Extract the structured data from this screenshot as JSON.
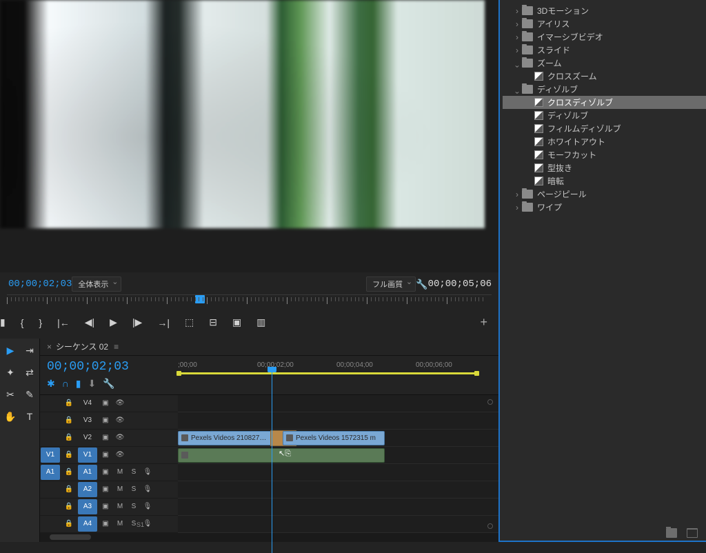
{
  "preview": {
    "timecode_left": "00;00;02;03",
    "fit_dropdown": "全体表示",
    "quality_dropdown": "フル画質",
    "timecode_right": "00;00;05;06"
  },
  "transport": {
    "add_marker": "▼",
    "mark_in": "{",
    "mark_out": "}",
    "go_in": "|←",
    "step_back": "◀|",
    "play": "▶",
    "step_fwd": "|▶",
    "go_out": "→|",
    "lift": "⬚",
    "extract": "⬚⬚",
    "snapshot": "📷",
    "export": "▦"
  },
  "effects": {
    "items": [
      {
        "type": "folder",
        "level": 1,
        "arrow": "closed",
        "label": "3Dモーション"
      },
      {
        "type": "folder",
        "level": 1,
        "arrow": "closed",
        "label": "アイリス"
      },
      {
        "type": "folder",
        "level": 1,
        "arrow": "closed",
        "label": "イマーシブビデオ"
      },
      {
        "type": "folder",
        "level": 1,
        "arrow": "closed",
        "label": "スライド"
      },
      {
        "type": "folder",
        "level": 1,
        "arrow": "open",
        "label": "ズーム"
      },
      {
        "type": "effect",
        "level": 2,
        "label": "クロスズーム"
      },
      {
        "type": "folder",
        "level": 1,
        "arrow": "open",
        "label": "ディゾルブ"
      },
      {
        "type": "effect",
        "level": 2,
        "label": "クロスディゾルブ",
        "selected": true
      },
      {
        "type": "effect",
        "level": 2,
        "label": "ディゾルブ"
      },
      {
        "type": "effect",
        "level": 2,
        "label": "フィルムディゾルブ"
      },
      {
        "type": "effect",
        "level": 2,
        "label": "ホワイトアウト"
      },
      {
        "type": "effect",
        "level": 2,
        "label": "モーフカット"
      },
      {
        "type": "effect",
        "level": 2,
        "label": "型抜き"
      },
      {
        "type": "effect",
        "level": 2,
        "label": "暗転"
      },
      {
        "type": "folder",
        "level": 1,
        "arrow": "closed",
        "label": "ページピール"
      },
      {
        "type": "folder",
        "level": 1,
        "arrow": "closed",
        "label": "ワイプ"
      }
    ]
  },
  "timeline": {
    "tab_name": "シーケンス 02",
    "timecode": "00;00;02;03",
    "ruler_ticks": [
      ";00;00",
      "00;00;02;00",
      "00;00;04;00",
      "00;00;06;00"
    ],
    "zoom_label": "S1",
    "tracks": {
      "video": [
        {
          "src": "",
          "tgt": "V4"
        },
        {
          "src": "",
          "tgt": "V3"
        },
        {
          "src": "",
          "tgt": "V2"
        },
        {
          "src": "V1",
          "tgt": "V1",
          "active": true
        }
      ],
      "audio": [
        {
          "src": "A1",
          "tgt": "A1",
          "active": true
        },
        {
          "src": "",
          "tgt": "A2",
          "tgt_active": true
        },
        {
          "src": "",
          "tgt": "A3",
          "tgt_active": true
        },
        {
          "src": "",
          "tgt": "A4",
          "tgt_active": true
        }
      ]
    },
    "clips": {
      "clip1_label": "Pexels Videos 210827…",
      "clip2_label": "Pexels Videos 1572315 m"
    }
  }
}
